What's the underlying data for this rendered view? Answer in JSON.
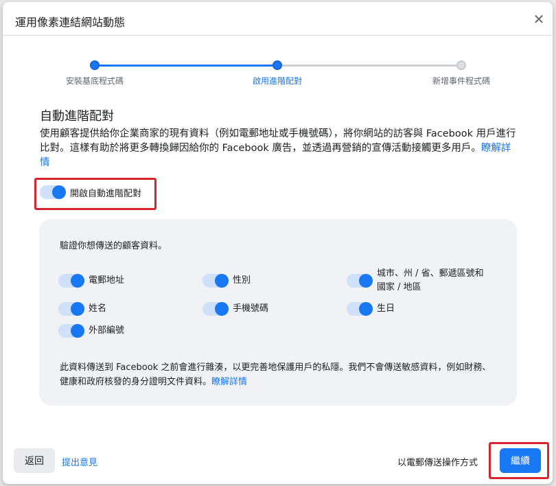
{
  "dialog": {
    "title": "運用像素連結網站動態",
    "close_icon": "close-icon"
  },
  "stepper": {
    "steps": [
      {
        "label": "安裝基底程式碼",
        "state": "done"
      },
      {
        "label": "啟用進階配對",
        "state": "current"
      },
      {
        "label": "新增事件程式碼",
        "state": "todo"
      }
    ]
  },
  "section": {
    "title": "自動進階配對",
    "description": "使用顧客提供給你企業商家的現有資料（例如電郵地址或手機號碼），將你網站的訪客與 Facebook 用戶進行比對。這樣有助於將更多轉換歸因給你的 Facebook 廣告，並透過再營銷的宣傳活動接觸更多用戶。",
    "learn_more": "瞭解詳情"
  },
  "main_toggle": {
    "label": "開啟自動進階配對",
    "on": true
  },
  "panel": {
    "title": "驗證你想傳送的顧客資料。",
    "options": [
      {
        "label": "電郵地址",
        "on": true
      },
      {
        "label": "性別",
        "on": true
      },
      {
        "label": "城市、州 / 省、郵遞區號和國家 / 地區",
        "on": true
      },
      {
        "label": "姓名",
        "on": true
      },
      {
        "label": "手機號碼",
        "on": true
      },
      {
        "label": "生日",
        "on": true
      },
      {
        "label": "外部編號",
        "on": true
      }
    ],
    "note": "此資料傳送到 Facebook 之前會進行雜湊，以更完善地保護用戶的私隱。我們不會傳送敏感資料，例如財務、健康和政府核發的身分證明文件資料。",
    "note_link": "瞭解詳情"
  },
  "footer": {
    "back_label": "返回",
    "feedback_label": "提出意見",
    "email_label": "以電郵傳送操作方式",
    "continue_label": "繼續"
  },
  "colors": {
    "accent": "#1877f2",
    "highlight": "#d9232d",
    "panel_bg": "#f0f2f5"
  }
}
